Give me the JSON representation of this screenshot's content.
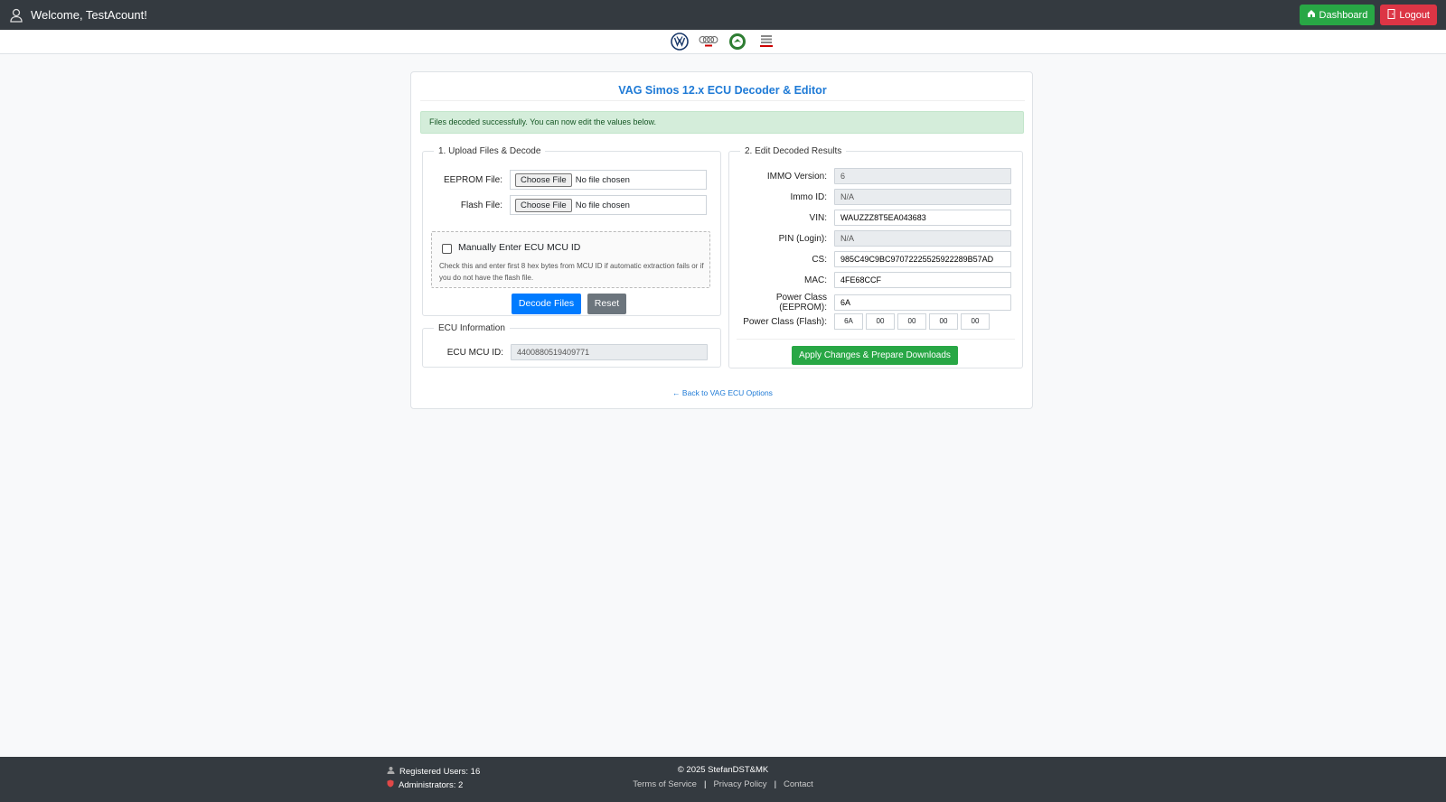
{
  "header": {
    "welcome": "Welcome, TestAcount!",
    "dashboard_label": "Dashboard",
    "logout_label": "Logout"
  },
  "brands": [
    "vw-logo",
    "audi-logo",
    "skoda-logo",
    "seat-logo"
  ],
  "card": {
    "title": "VAG Simos 12.x ECU Decoder & Editor",
    "alert": "Files decoded successfully. You can now edit the values below."
  },
  "upload": {
    "legend": "1. Upload Files & Decode",
    "eeprom_label": "EEPROM File:",
    "flash_label": "Flash File:",
    "choose_label": "Choose File",
    "no_file": "No file chosen",
    "manual_label": "Manually Enter ECU MCU ID",
    "manual_help": "Check this and enter first 8 hex bytes from MCU ID if automatic extraction fails or if you do not have the flash file.",
    "decode_label": "Decode Files",
    "reset_label": "Reset"
  },
  "ecu_info": {
    "legend": "ECU Information",
    "mcu_label": "ECU MCU ID:",
    "mcu_value": "4400880519409771"
  },
  "results": {
    "legend": "2. Edit Decoded Results",
    "immo_version_label": "IMMO Version:",
    "immo_version": "6",
    "immo_id_label": "Immo ID:",
    "immo_id": "N/A",
    "vin_label": "VIN:",
    "vin": "WAUZZZ8T5EA043683",
    "pin_label": "PIN (Login):",
    "pin": "N/A",
    "cs_label": "CS:",
    "cs": "985C49C9BC97072225525922289B57AD",
    "mac_label": "MAC:",
    "mac": "4FE68CCF",
    "pc_eeprom_label": "Power Class (EEPROM):",
    "pc_eeprom": "6A",
    "pc_flash_label": "Power Class (Flash):",
    "pc_flash": [
      "6A",
      "00",
      "00",
      "00",
      "00"
    ],
    "apply_label": "Apply Changes & Prepare Downloads"
  },
  "back_link": "← Back to VAG ECU Options",
  "footer": {
    "registered": "Registered Users: 16",
    "admins": "Administrators: 2",
    "copyright": "© 2025 StefanDST&MK",
    "terms": "Terms of Service",
    "privacy": "Privacy Policy",
    "contact": "Contact",
    "separator": "|"
  },
  "colors": {
    "navbar": "#343a40",
    "primary": "#007bff",
    "success": "#28a745",
    "danger": "#dc3545",
    "title_blue": "#1e7ad6"
  }
}
